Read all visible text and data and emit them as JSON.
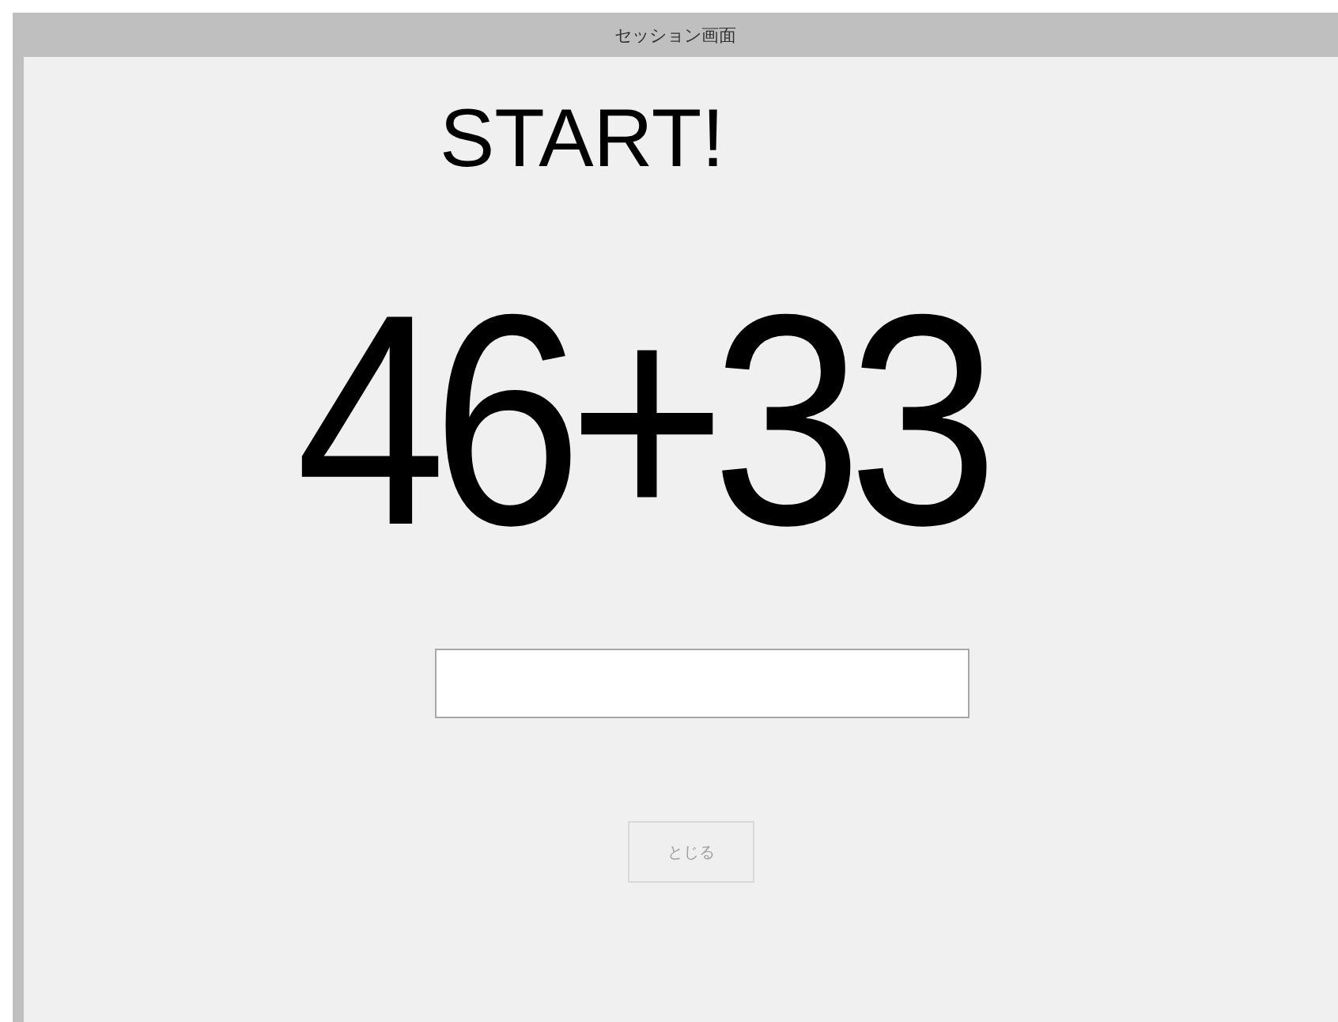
{
  "window": {
    "title": "セッション画面"
  },
  "heading": "START!",
  "problem": "46+33",
  "close_button": {
    "label": "とじる",
    "disabled": true
  }
}
